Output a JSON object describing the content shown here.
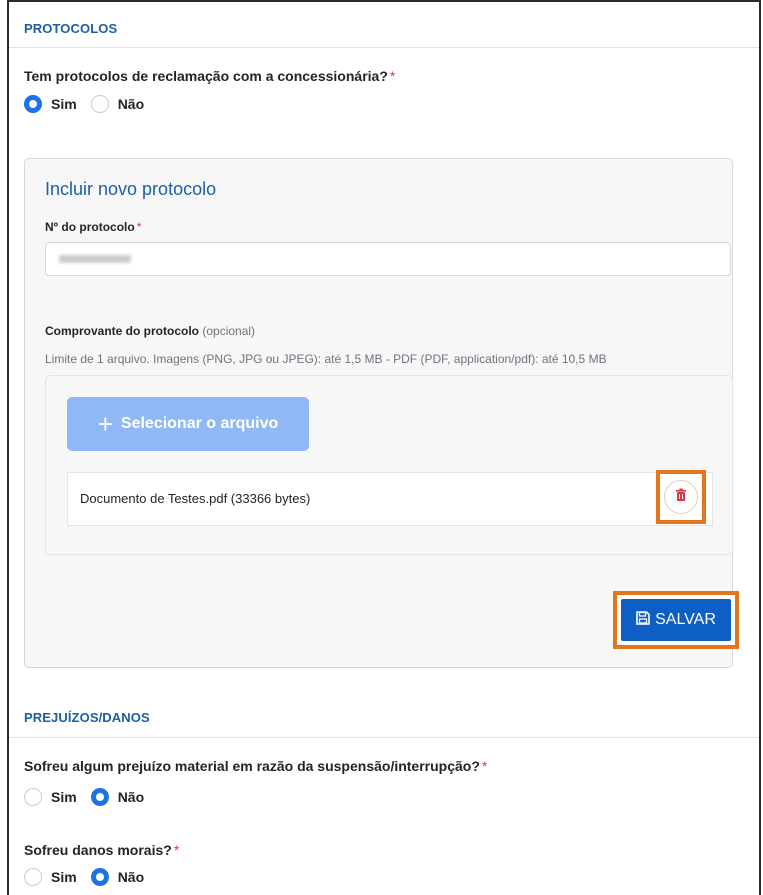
{
  "protocolos": {
    "header": "PROTOCOLOS",
    "question": "Tem protocolos de reclamação com a concessionária?",
    "required_mark": "*",
    "options": [
      "Sim",
      "Não"
    ],
    "selected": "Sim"
  },
  "novo_protocolo": {
    "title": "Incluir novo protocolo",
    "numero_label": "Nº do protocolo",
    "required_mark": "*",
    "numero_value": "",
    "comprovante_label": "Comprovante do protocolo",
    "comprovante_optional": "(opcional)",
    "limit_hint": "Limite de 1 arquivo. Imagens (PNG, JPG ou JPEG): até 1,5 MB - PDF (PDF, application/pdf): até 10,5 MB",
    "select_button": "Selecionar o arquivo",
    "file_name": "Documento de Testes.pdf (33366 bytes)",
    "delete_icon": "trash-icon",
    "save_button": "SALVAR",
    "save_icon": "floppy-disk-icon"
  },
  "prejuizos": {
    "header": "PREJUÍZOS/DANOS",
    "q1": "Sofreu algum prejuízo material em razão da suspensão/interrupção?",
    "q1_options": [
      "Sim",
      "Não"
    ],
    "q1_selected": "Não",
    "q2": "Sofreu danos morais?",
    "q2_options": [
      "Sim",
      "Não"
    ],
    "q2_selected": "Não",
    "required_mark": "*"
  },
  "colors": {
    "accent": "#1a73e8",
    "header_blue": "#1c5fa8",
    "save_button": "#0d5ec5",
    "select_button_disabled": "#8fb8f5",
    "highlight_orange": "#e2761b",
    "danger": "#dc3545"
  }
}
